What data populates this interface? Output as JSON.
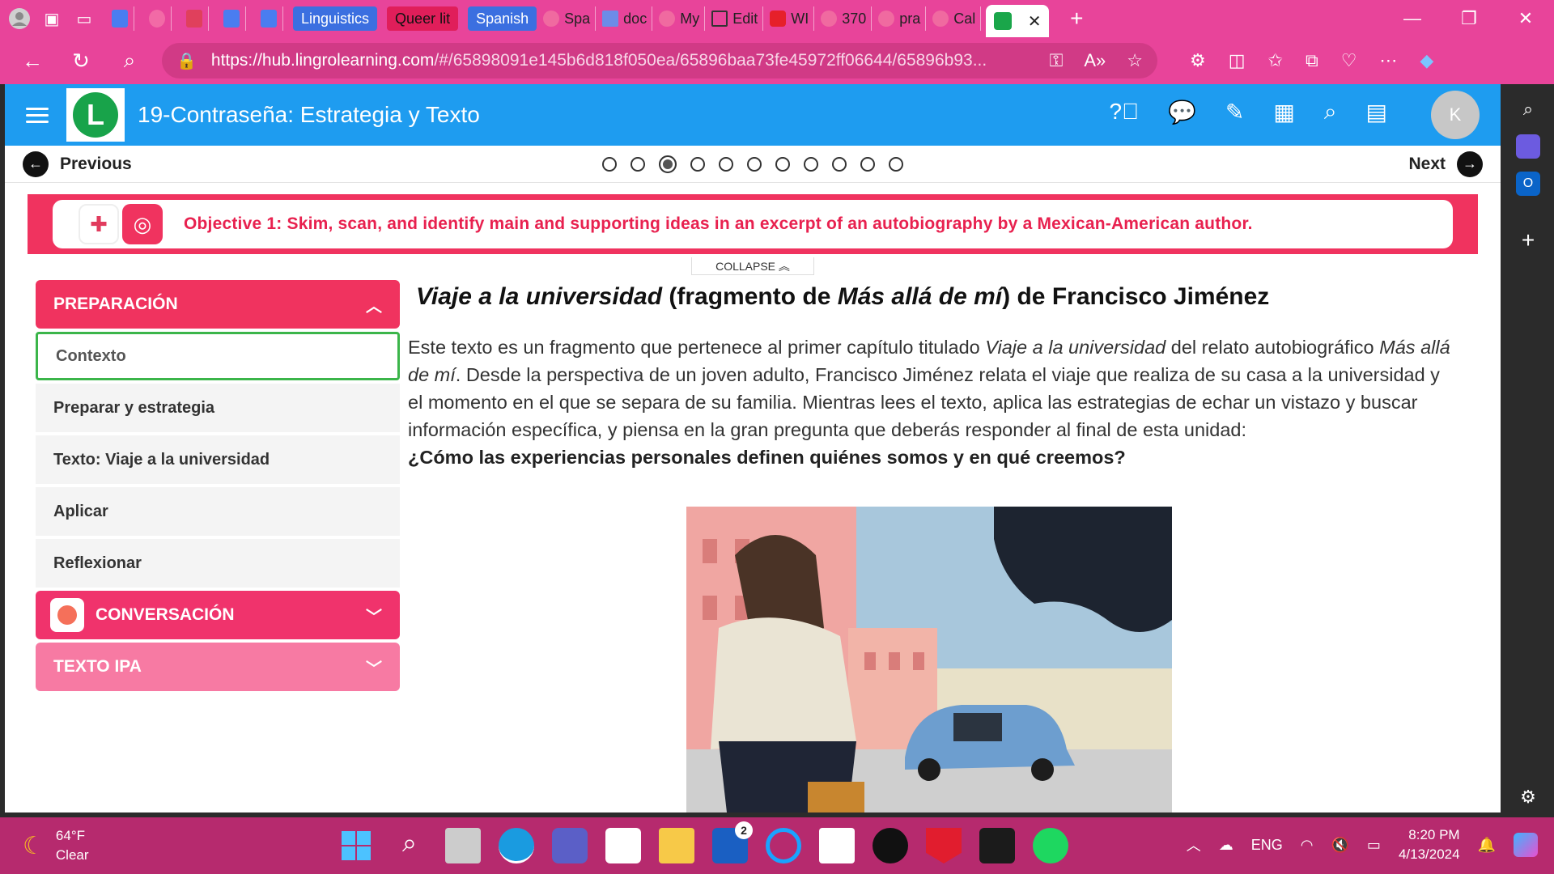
{
  "browser": {
    "tab_groups": [
      "Linguistics",
      "Queer lit",
      "Spanish"
    ],
    "tabs": [
      "Spa",
      "doc",
      "My",
      "Edit",
      "WI",
      "370",
      "pra",
      "Cal"
    ],
    "url_host": "https://hub.lingrolearning.com",
    "url_path": "/#/65898091e145b6d818f050ea/65896baa73fe45972ff06644/65896b93..."
  },
  "app": {
    "course_title": "19-Contraseña: Estrategia y Texto",
    "avatar_initial": "K",
    "previous_label": "Previous",
    "next_label": "Next",
    "pages_total": 11,
    "pages_current": 3,
    "objective": "Objective 1: Skim, scan, and identify main and supporting ideas in an excerpt of an autobiography by a Mexican-American author.",
    "collapse_label": "COLLAPSE"
  },
  "sidebar": {
    "sections": [
      {
        "label": "PREPARACIÓN"
      },
      {
        "label": "CONVERSACIÓN"
      },
      {
        "label": "TEXTO IPA"
      }
    ],
    "items": [
      "Contexto",
      "Preparar y estrategia",
      "Texto: Viaje a la universidad",
      "Aplicar",
      "Reflexionar"
    ]
  },
  "content": {
    "title_italic_1": "Viaje a la universidad",
    "title_plain_1": " (fragmento de ",
    "title_italic_2": "Más allá de mí",
    "title_plain_2": ") de Francisco Jiménez",
    "intro_1": "Este texto es un fragmento que pertenece al primer capítulo titulado ",
    "intro_italic_1": "Viaje a la universidad",
    "intro_2": " del relato autobiográfico ",
    "intro_italic_2": "Más allá de mí",
    "intro_3": ". Desde la perspectiva de un joven adulto, Francisco Jiménez relata el viaje que realiza de su casa a la universidad y el momento en el que se separa de su familia. Mientras lees el texto, aplica las estrategias de echar un vistazo y buscar información específica, y piensa en la gran pregunta que deberás responder al final de esta unidad:",
    "question": "¿Cómo las experiencias personales definen quiénes somos y en qué creemos?"
  },
  "taskbar": {
    "temp": "64°F",
    "weather": "Clear",
    "lang": "ENG",
    "time": "8:20 PM",
    "date": "4/13/2024",
    "badge": "2"
  },
  "colors": {
    "browser_chrome": "#e8449a",
    "app_header": "#1e9cf0",
    "accent_red": "#f0335f",
    "accent_pink": "#f77aa3",
    "current_border": "#3bb54a"
  }
}
